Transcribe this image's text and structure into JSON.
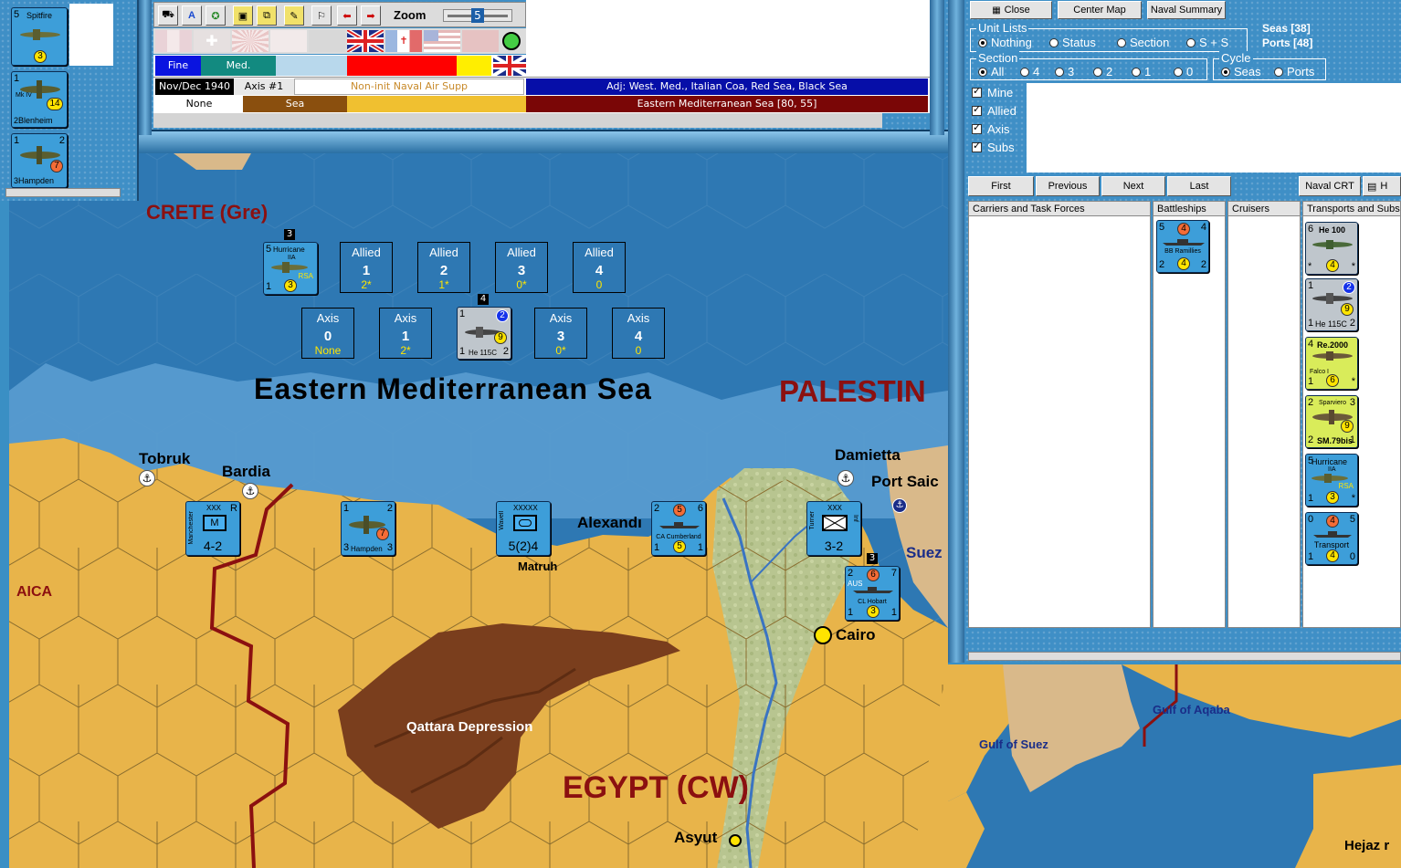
{
  "left_stack": {
    "counters": [
      {
        "name": "Spitfire",
        "tl": "5",
        "center": "3"
      },
      {
        "name": "Blenheim",
        "sub": "Mk IV",
        "tl": "1",
        "bl": "2",
        "center": "14"
      },
      {
        "name": "Hampden",
        "tl": "1",
        "tr": "2",
        "bl": "3",
        "center": "7"
      }
    ]
  },
  "toolbar": {
    "zoom_label": "Zoom",
    "zoom_value": "5"
  },
  "info": {
    "weather": "Fine",
    "sea_state": "Med.",
    "date": "Nov/Dec 1940",
    "phase": "Axis #1",
    "naval_air": "Non-init Naval Air Supp",
    "adjacent": "Adj: West. Med., Italian Coa, Red Sea, Black Sea",
    "cell_none": "None",
    "cell_sea": "Sea",
    "area": "Eastern Mediterranean Sea [80, 55]"
  },
  "map": {
    "labels": {
      "crete": "CRETE (Gre)",
      "sea": "Eastern Mediterranean Sea",
      "palestine": "PALESTIN",
      "egypt": "EGYPT (CW)",
      "aica": "AICA",
      "qattara": "Qattara Depression",
      "gulf_suez": "Gulf of Suez",
      "gulf_aqaba": "Gulf of Aqaba"
    },
    "cities": {
      "tobruk": "Tobruk",
      "bardia": "Bardia",
      "alexandria": "Alexandı",
      "matruh": "Matruh",
      "damietta": "Damietta",
      "port_said": "Port Saic",
      "suez": "Suez",
      "cairo": "Cairo",
      "asyut": "Asyut",
      "hejaz": "Hejaz r"
    },
    "sea_boxes": {
      "allied": [
        {
          "label": "Allied",
          "num": "1",
          "val": "2*"
        },
        {
          "label": "Allied",
          "num": "2",
          "val": "1*"
        },
        {
          "label": "Allied",
          "num": "3",
          "val": "0*"
        },
        {
          "label": "Allied",
          "num": "4",
          "val": "0"
        }
      ],
      "axis": [
        {
          "label": "Axis",
          "num": "0",
          "val": "None"
        },
        {
          "label": "Axis",
          "num": "1",
          "val": "2*"
        },
        {
          "label": "Axis",
          "num": "3",
          "val": "0*"
        },
        {
          "label": "Axis",
          "num": "4",
          "val": "0"
        }
      ]
    },
    "units": {
      "hurricane": {
        "name": "Hurricane",
        "sub": "IIA",
        "tag": "RSA",
        "tl": "5",
        "bl": "1",
        "center": "3",
        "stack": "3"
      },
      "he115": {
        "name": "He 115C",
        "tl": "1",
        "bl": "1",
        "br": "2",
        "blue": "2",
        "center": "9",
        "stack": "4"
      },
      "manchester": {
        "name": "Manchester",
        "corps": "XXX",
        "tr": "R",
        "value": "4-2"
      },
      "hampden": {
        "name": "Hampden",
        "tl": "1",
        "tr": "2",
        "bl": "3",
        "br": "3",
        "center": "7"
      },
      "wavell": {
        "name": "Wavell",
        "corps": "XXXXX",
        "value": "5(2)4"
      },
      "cumberland": {
        "name": "CA Cumberland",
        "tl": "2",
        "tr": "6",
        "bl": "1",
        "br": "1",
        "orange": "5",
        "center": "5"
      },
      "turner": {
        "name": "Turner",
        "corps": "XXX",
        "side": "Inf",
        "value": "3-2"
      },
      "hobart": {
        "name": "CL Hobart",
        "tag": "AUS",
        "tl": "2",
        "tr": "7",
        "bl": "1",
        "br": "1",
        "orange": "6",
        "center": "3",
        "stack": "3"
      }
    }
  },
  "naval_panel": {
    "buttons": {
      "close": "Close",
      "center_map": "Center Map",
      "naval_summary": "Naval Summary",
      "first": "First",
      "previous": "Previous",
      "next": "Next",
      "last": "Last",
      "naval_crt": "Naval CRT",
      "help": "H"
    },
    "seas_count": "Seas [38]",
    "ports_count": "Ports [48]",
    "unit_lists": {
      "legend": "Unit Lists",
      "options": [
        "Nothing",
        "Status",
        "Section",
        "S + S"
      ],
      "selected": "Nothing"
    },
    "section": {
      "legend": "Section",
      "options": [
        "All",
        "4",
        "3",
        "2",
        "1",
        "0"
      ],
      "selected": "All"
    },
    "cycle": {
      "legend": "Cycle",
      "options": [
        "Seas",
        "Ports"
      ],
      "selected": "Seas"
    },
    "filters": [
      "Mine",
      "Allied",
      "Axis",
      "Subs"
    ],
    "columns": [
      "Carriers and Task Forces",
      "Battleships",
      "Cruisers",
      "Transports and Subs"
    ],
    "battleships": [
      {
        "name": "BB Ramillies",
        "tl": "5",
        "tr": "4",
        "bl": "2",
        "br": "2",
        "orange": "4",
        "center": "4"
      }
    ],
    "transports": [
      {
        "name": "He 100",
        "tl": "6",
        "center": "4",
        "bl": "*",
        "br": "*"
      },
      {
        "name": "He 115C",
        "tl": "1",
        "blue": "2",
        "center": "9",
        "bl": "1",
        "br": "2"
      },
      {
        "name": "Re.2000",
        "sub": "Falco I",
        "tl": "4",
        "center": "6",
        "bl": "1",
        "br": "*"
      },
      {
        "name": "SM.79bis",
        "sub": "Sparviero",
        "tl": "2",
        "tr": "3",
        "center": "9",
        "bl": "2",
        "br": "1"
      },
      {
        "name": "Hurricane",
        "sub": "IIA",
        "tag": "RSA",
        "tl": "5",
        "center": "3",
        "bl": "1",
        "br": "*"
      },
      {
        "name": "Transport",
        "tl": "0",
        "tr": "5",
        "orange": "4",
        "center": "4",
        "bl": "1",
        "br": "0"
      }
    ]
  },
  "colors": {
    "sea": "#2e78b3",
    "desert": "#e8b44a",
    "counter_blue": "#3d9ed9",
    "counter_grey": "#bfc6cc",
    "counter_green": "#d9ec5a",
    "counter_white": "#ffffff",
    "dark_red": "#8b1010",
    "navy": "#060ea8"
  }
}
